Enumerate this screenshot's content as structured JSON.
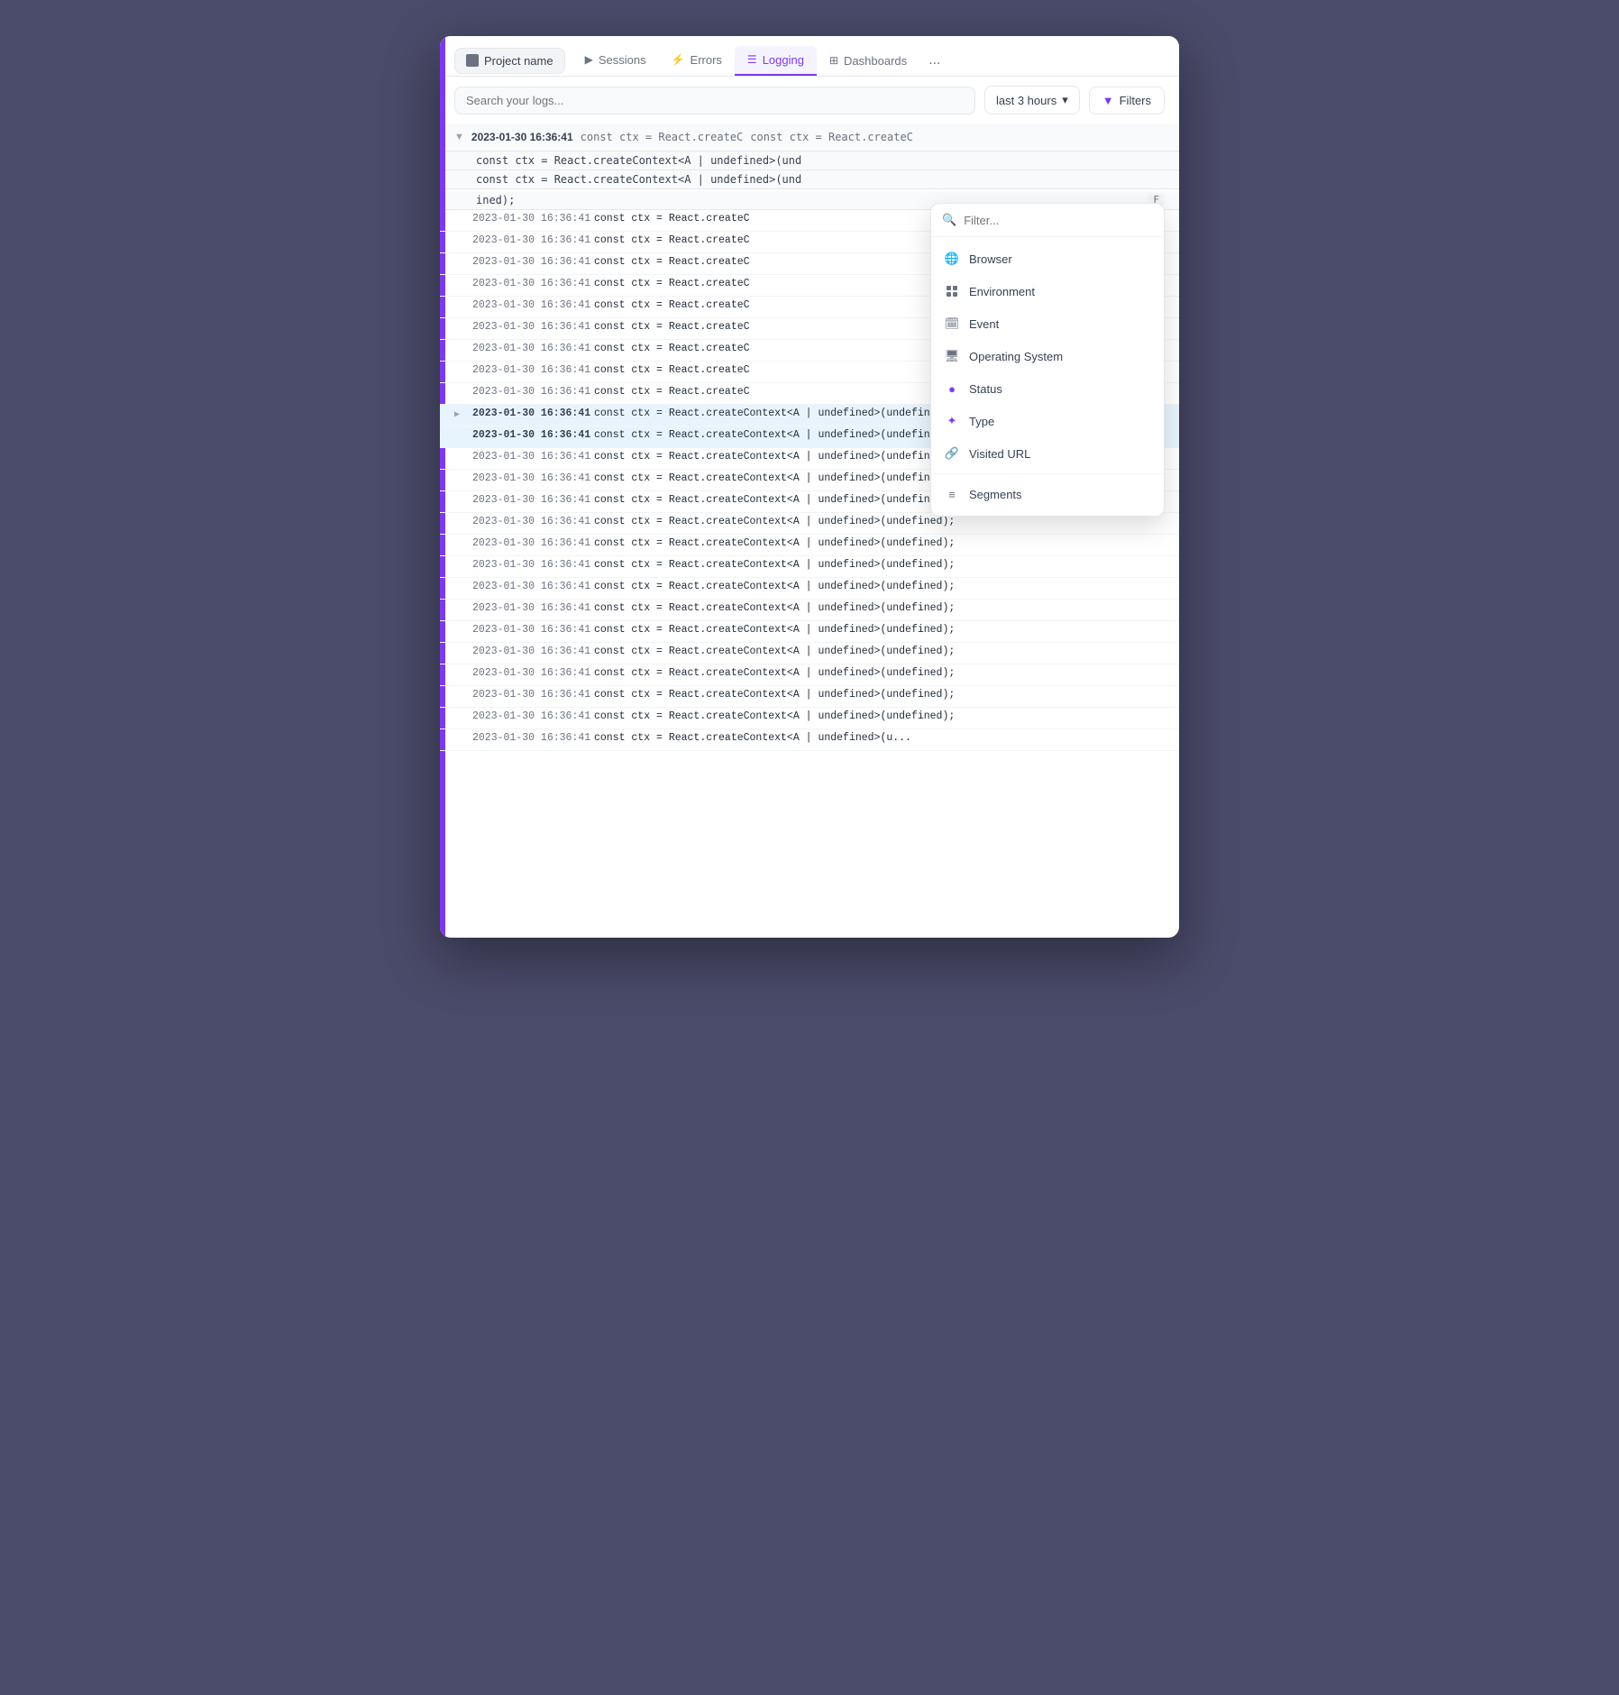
{
  "window": {
    "title": "Project name"
  },
  "topbar": {
    "project_label": "Project name",
    "tabs": [
      {
        "id": "sessions",
        "label": "Sessions",
        "icon": "▶"
      },
      {
        "id": "errors",
        "label": "Errors",
        "icon": "⚡"
      },
      {
        "id": "logging",
        "label": "Logging",
        "icon": "☰",
        "active": true
      },
      {
        "id": "dashboards",
        "label": "Dashboards",
        "icon": "⊞"
      }
    ],
    "more_label": "..."
  },
  "toolbar": {
    "search_placeholder": "Search your logs...",
    "time_range": "last 3 hours",
    "filters_label": "Filters",
    "chevron": "▾"
  },
  "log_header": {
    "timestamp": "2023-01-30 16:36:41",
    "code": "const ctx = React.createContext<A | undefined>(undefined);"
  },
  "logs": [
    {
      "id": 1,
      "timestamp": "2023-01-30 16:36:41",
      "code": "const ctx = React.createContext<A | undefined>(und",
      "expanded": false
    },
    {
      "id": 2,
      "timestamp": "2023-01-30 16:36:41",
      "code": "const ctx = React.createContext<A | undefined>(und",
      "expanded": false
    },
    {
      "id": 3,
      "timestamp": "2023-01-30 16:36:41",
      "code": "const ctx = React.createC",
      "expanded": false
    },
    {
      "id": 4,
      "timestamp": "2023-01-30 16:36:41",
      "code": "const ctx = React.createC",
      "expanded": false
    },
    {
      "id": 5,
      "timestamp": "2023-01-30 16:36:41",
      "code": "const ctx = React.createC",
      "expanded": false
    },
    {
      "id": 6,
      "timestamp": "2023-01-30 16:36:41",
      "code": "const ctx = React.createC",
      "expanded": false
    },
    {
      "id": 7,
      "timestamp": "2023-01-30 16:36:41",
      "code": "const ctx = React.createC",
      "expanded": false
    },
    {
      "id": 8,
      "timestamp": "2023-01-30 16:36:41",
      "code": "const ctx = React.createC",
      "expanded": false
    },
    {
      "id": 9,
      "timestamp": "2023-01-30 16:36:41",
      "code": "const ctx = React.createC",
      "expanded": false
    },
    {
      "id": 10,
      "timestamp": "2023-01-30 16:36:41",
      "code": "const ctx = React.createC",
      "expanded": false
    },
    {
      "id": 11,
      "timestamp": "2023-01-30 16:36:41",
      "code": "const ctx = React.createContext<A | undefined>(undefined);",
      "expanded": true
    },
    {
      "id": 12,
      "timestamp": "2023-01-30 16:36:41",
      "code": "const ctx = React.createContext<A | undefined>(undefined);",
      "expanded": false
    },
    {
      "id": 13,
      "timestamp": "2023-01-30 16:36:41",
      "code": "const ctx = React.createContext<A | undefined>(undefined);",
      "expanded": false
    },
    {
      "id": 14,
      "timestamp": "2023-01-30 16:36:41",
      "code": "const ctx = React.createContext<A | undefined>(undefined);",
      "expanded": false
    },
    {
      "id": 15,
      "timestamp": "2023-01-30 16:36:41",
      "code": "const ctx = React.createContext<A | undefined>(undefined);",
      "expanded": false
    },
    {
      "id": 16,
      "timestamp": "2023-01-30 16:36:41",
      "code": "const ctx = React.createContext<A | undefined>(undefined);",
      "expanded": false
    },
    {
      "id": 17,
      "timestamp": "2023-01-30 16:36:41",
      "code": "const ctx = React.createContext<A | undefined>(undefined);",
      "expanded": false
    },
    {
      "id": 18,
      "timestamp": "2023-01-30 16:36:41",
      "code": "const ctx = React.createContext<A | undefined>(undefined);",
      "expanded": false
    },
    {
      "id": 19,
      "timestamp": "2023-01-30 16:36:41",
      "code": "const ctx = React.createContext<A | undefined>(undefined);",
      "expanded": false
    },
    {
      "id": 20,
      "timestamp": "2023-01-30 16:36:41",
      "code": "const ctx = React.createContext<A | undefined>(undefined);",
      "expanded": false
    },
    {
      "id": 21,
      "timestamp": "2023-01-30 16:36:41",
      "code": "const ctx = React.createContext<A | undefined>(undefined);",
      "expanded": false
    },
    {
      "id": 22,
      "timestamp": "2023-01-30 16:36:41",
      "code": "const ctx = React.createContext<A | undefined>(undefined);",
      "expanded": false
    },
    {
      "id": 23,
      "timestamp": "2023-01-30 16:36:41",
      "code": "const ctx = React.createContext<A | undefined>(undefined);",
      "expanded": false
    },
    {
      "id": 24,
      "timestamp": "2023-01-30 16:36:41",
      "code": "const ctx = React.createContext<A | undefined>(undefined);",
      "expanded": false
    },
    {
      "id": 25,
      "timestamp": "2023-01-30 16:36:41",
      "code": "const ctx = React.createContext<A | undefined>(undefined);",
      "expanded": false
    }
  ],
  "dropdown": {
    "search_placeholder": "Filter...",
    "items": [
      {
        "id": "browser",
        "label": "Browser",
        "icon": "🌐"
      },
      {
        "id": "environment",
        "label": "Environment",
        "icon": "⊞"
      },
      {
        "id": "event",
        "label": "Event",
        "icon": "🗓"
      },
      {
        "id": "operating_system",
        "label": "Operating System",
        "icon": "🖥"
      },
      {
        "id": "status",
        "label": "Status",
        "icon": "●"
      },
      {
        "id": "type",
        "label": "Type",
        "icon": "✦"
      },
      {
        "id": "visited_url",
        "label": "Visited URL",
        "icon": "🔗"
      }
    ],
    "segments_label": "Segments",
    "segments": [
      {
        "id": "segments",
        "label": "Segments",
        "icon": "≡"
      }
    ]
  },
  "colors": {
    "accent": "#7c3aed",
    "border": "#e5e7eb",
    "text_primary": "#1f2937",
    "text_secondary": "#6b7280"
  }
}
